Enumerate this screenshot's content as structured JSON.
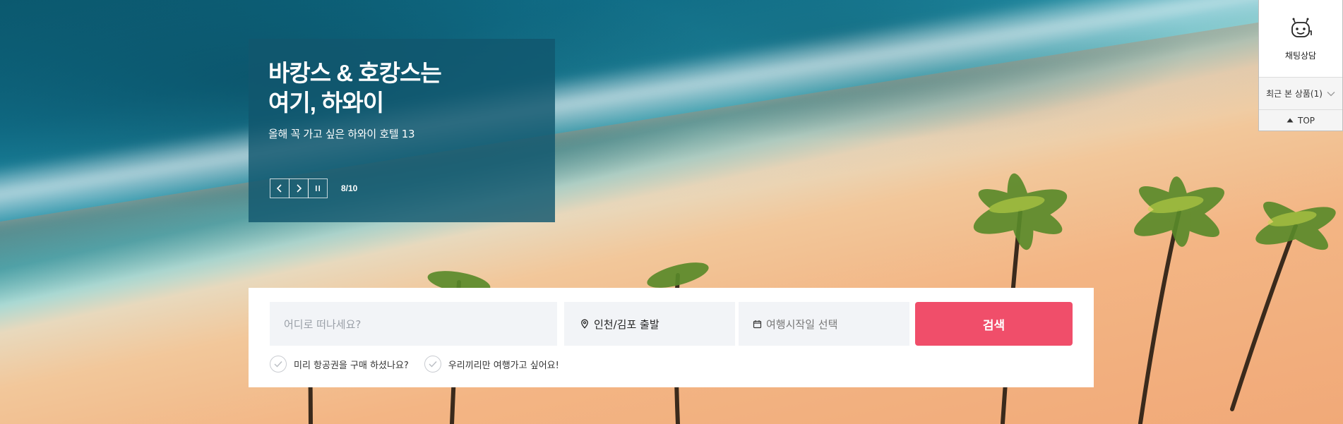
{
  "banner": {
    "title_line1": "바캉스 & 호캉스는",
    "title_line2": "여기, 하와이",
    "subtitle": "올해 꼭 가고 싶은 하와이 호텔 13",
    "counter": "8/10"
  },
  "search": {
    "destination_placeholder": "어디로 떠나세요?",
    "departure_value": "인천/김포 출발",
    "date_placeholder": "여행시작일 선택",
    "search_label": "검색",
    "options": [
      {
        "label": "미리 항공권을 구매 하셨나요?"
      },
      {
        "label": "우리끼리만 여행가고 싶어요!"
      }
    ]
  },
  "quick_menu": {
    "chat_label": "채팅상담",
    "recent_label": "최근 본 상품(1)",
    "top_label": "TOP"
  },
  "colors": {
    "banner_bg": "#11576e",
    "search_button": "#f04e6a",
    "field_bg": "#f2f4f7"
  },
  "icons": [
    "chevron-left-icon",
    "chevron-right-icon",
    "pause-icon",
    "location-pin-icon",
    "calendar-icon",
    "check-icon",
    "chatbot-icon",
    "chevron-down-icon",
    "triangle-up-icon"
  ]
}
